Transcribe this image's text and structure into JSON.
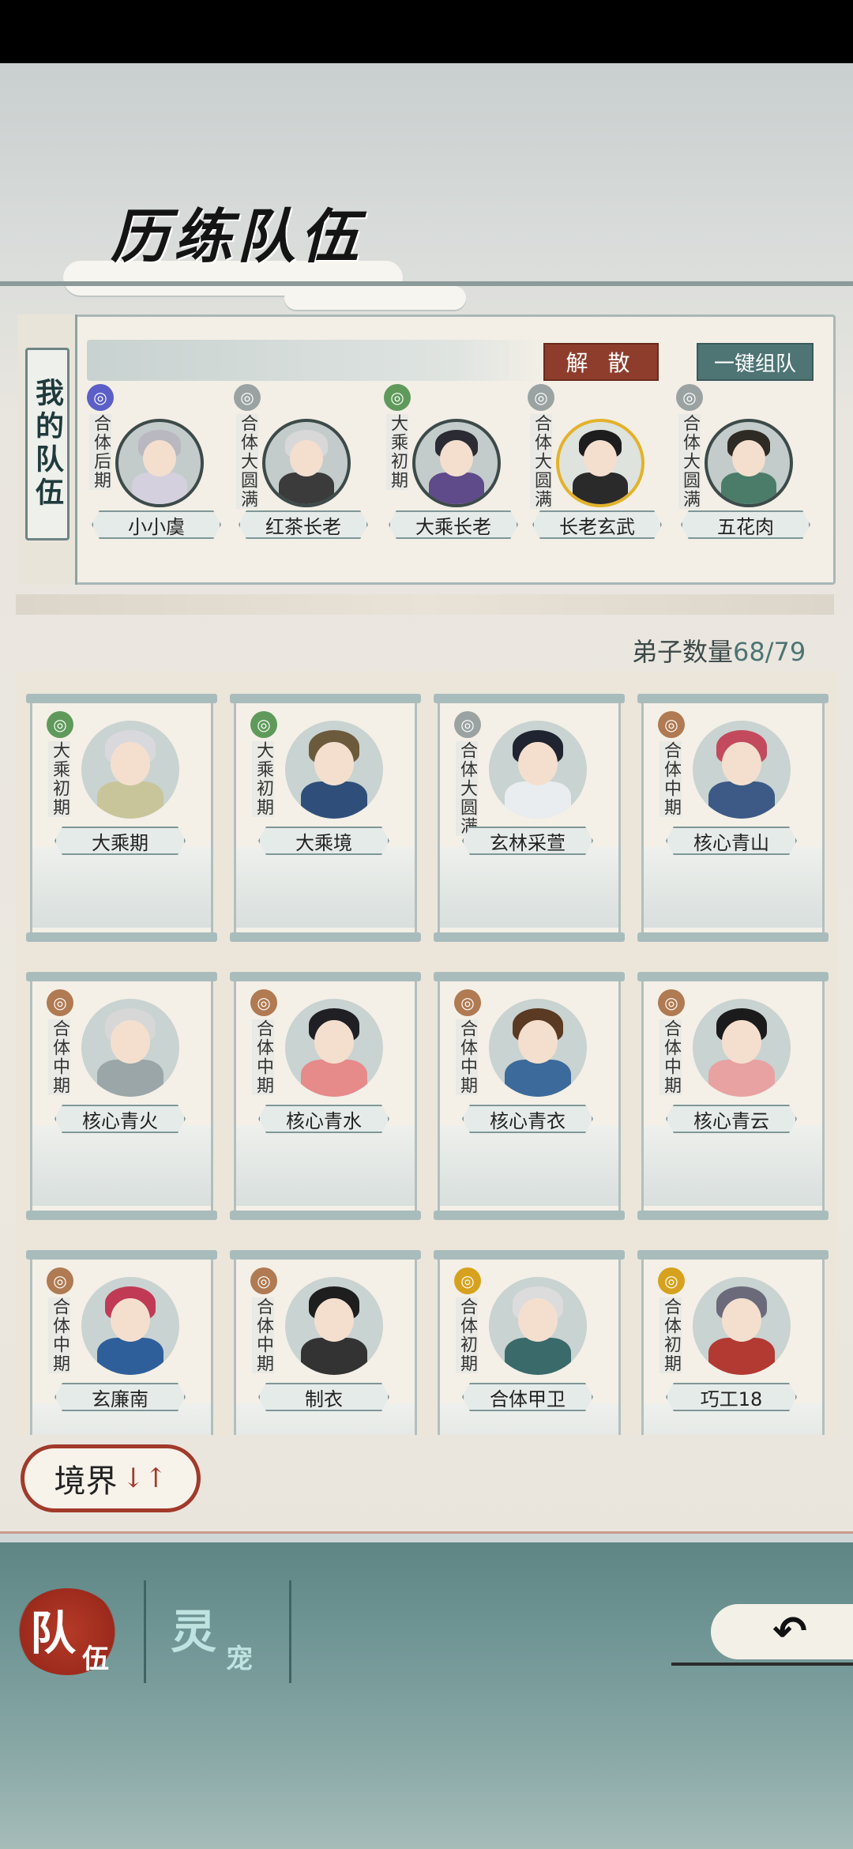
{
  "header": {
    "title": "历练队伍"
  },
  "team": {
    "label": "我的队伍",
    "disband_label": "解 散",
    "auto_team_label": "一键组队",
    "members": [
      {
        "name": "小小虞",
        "realm": "合体后期",
        "realm_color": "#5b5fc7",
        "hair": "#b9b7bf",
        "body": "#d5d0dd"
      },
      {
        "name": "红茶长老",
        "realm": "合体大圆满",
        "realm_color": "#9aa3a2",
        "hair": "#d8d8d8",
        "body": "#3b3b3b"
      },
      {
        "name": "大乘长老",
        "realm": "大乘初期",
        "realm_color": "#5f9a5b",
        "hair": "#2b2b33",
        "body": "#5f4a8a"
      },
      {
        "name": "长老玄武",
        "realm": "合体大圆满",
        "realm_color": "#9aa3a2",
        "hair": "#1d1d1d",
        "body": "#2a2a2a",
        "highlight": true
      },
      {
        "name": "五花肉",
        "realm": "合体大圆满",
        "realm_color": "#9aa3a2",
        "hair": "#2e2a24",
        "body": "#4b7c6a"
      }
    ]
  },
  "disciples": {
    "count_label": "弟子数量",
    "count_value": "68/79",
    "items": [
      {
        "name": "大乘期",
        "realm": "大乘初期",
        "realm_color": "#5f9a5b",
        "hair": "#d9d9dd",
        "body": "#c8c59a"
      },
      {
        "name": "大乘境",
        "realm": "大乘初期",
        "realm_color": "#5f9a5b",
        "hair": "#6b5a3c",
        "body": "#2f4f7a"
      },
      {
        "name": "玄林采萱",
        "realm": "合体大圆满",
        "realm_color": "#9aa3a2",
        "hair": "#1f2430",
        "body": "#e9edf0"
      },
      {
        "name": "核心青山",
        "realm": "合体中期",
        "realm_color": "#b07a52",
        "hair": "#c24a5c",
        "body": "#3c5a85"
      },
      {
        "name": "核心青火",
        "realm": "合体中期",
        "realm_color": "#b07a52",
        "hair": "#d7d7d7",
        "body": "#9aa6a8"
      },
      {
        "name": "核心青水",
        "realm": "合体中期",
        "realm_color": "#b07a52",
        "hair": "#1f1f24",
        "body": "#e68a8a"
      },
      {
        "name": "核心青衣",
        "realm": "合体中期",
        "realm_color": "#b07a52",
        "hair": "#5a3a22",
        "body": "#3c6a9a"
      },
      {
        "name": "核心青云",
        "realm": "合体中期",
        "realm_color": "#b07a52",
        "hair": "#1b1b1b",
        "body": "#e8a2a2"
      },
      {
        "name": "玄廉南",
        "realm": "合体中期",
        "realm_color": "#b07a52",
        "hair": "#c03a55",
        "body": "#2f5f9a"
      },
      {
        "name": "制衣",
        "realm": "合体中期",
        "realm_color": "#b07a52",
        "hair": "#1e1e1e",
        "body": "#333333"
      },
      {
        "name": "合体甲卫",
        "realm": "合体初期",
        "realm_color": "#d6a21e",
        "hair": "#dcdcdc",
        "body": "#3a6a6a"
      },
      {
        "name": "巧工18",
        "realm": "合体初期",
        "realm_color": "#d6a21e",
        "hair": "#6a6a7a",
        "body": "#b23a33"
      }
    ]
  },
  "sort": {
    "label": "境界",
    "arrows": "↓↑"
  },
  "tabs": {
    "team": {
      "big": "队",
      "small": "伍"
    },
    "pet": {
      "big": "灵",
      "small": "宠"
    }
  },
  "back_icon_glyph": "↶"
}
